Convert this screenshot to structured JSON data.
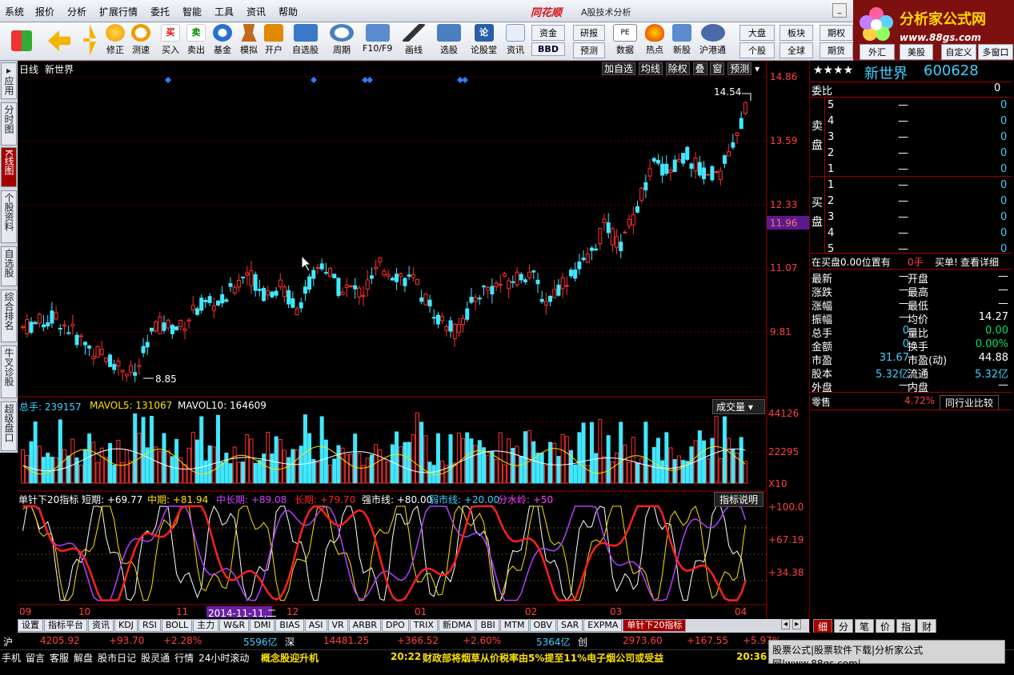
{
  "menubar": {
    "items": [
      "系统",
      "报价",
      "分析",
      "扩展行情",
      "委托",
      "智能",
      "工具",
      "资讯",
      "帮助"
    ],
    "brand": "同花顺",
    "subtitle": "A股技术分析"
  },
  "logo": {
    "title": "分析家公式网",
    "url": "www.88gs.com"
  },
  "toolbar": {
    "buttons": [
      "修正",
      "测速",
      "买入",
      "卖出",
      "基金",
      "模拟",
      "开户",
      "自选股",
      "周期",
      "F10/F9",
      "画线",
      "选股",
      "论股堂",
      "资讯",
      "数据",
      "热点",
      "新股",
      "沪港通"
    ],
    "small": [
      "资金",
      "研报",
      "BBD",
      "预测",
      "大盘",
      "板块",
      "期权",
      "个股",
      "全球",
      "期货",
      "外汇",
      "美股",
      "自定义",
      "多窗口"
    ]
  },
  "sidetabs": [
    "应用",
    "分时图",
    "K线图",
    "个股资料",
    "自选股",
    "综合排名",
    "牛叉诊股",
    "超级盘口"
  ],
  "chart": {
    "period": "日线",
    "stock": "新世界",
    "right_tools": [
      "加自选",
      "均线",
      "除权",
      "叠",
      "窗",
      "预测"
    ],
    "price_axis": [
      "14.86",
      "13.59",
      "12.33",
      "11.07",
      "9.81"
    ],
    "current_price": "11.96",
    "high_label": "14.54",
    "low_label": "8.85",
    "volume": {
      "label": "总手: 239157",
      "ma5": "MAVOL5: 131067",
      "ma10": "MAVOL10: 164609",
      "selector": "成交量",
      "axis": [
        "44126",
        "22295",
        "X10"
      ]
    },
    "indicator": {
      "name": "单针下20指标",
      "short": "短期: +69.77",
      "mid": "中期: +81.94",
      "midlong": "中长期: +89.08",
      "long": "长期: +79.70",
      "strong": "强市线: +80.00",
      "weak": "弱市线: +20.00",
      "water": "分水岭: +50",
      "help": "指标说明",
      "axis": [
        "+100.0",
        "+67.19",
        "+34.38"
      ]
    },
    "date_axis": [
      "09",
      "10",
      "11",
      "2014-11-11,二",
      "12",
      "01",
      "02",
      "03",
      "04"
    ]
  },
  "bottom_tabs": [
    "设置",
    "指标平台",
    "资讯",
    "KDJ",
    "RSI",
    "BOLL",
    "主力",
    "W&R",
    "DMI",
    "BIAS",
    "ASI",
    "VR",
    "ARBR",
    "DPO",
    "TRIX",
    "新DMA",
    "BBI",
    "MTM",
    "OBV",
    "SAR",
    "EXPMA",
    "单针下20指标"
  ],
  "right_tabs": [
    "细",
    "分",
    "笔",
    "价",
    "指",
    "财"
  ],
  "quote": {
    "stars": "★★★★",
    "name": "新世界",
    "code": "600628",
    "weibi_label": "委比",
    "weibi_val": "0",
    "sell_label": "卖盘",
    "buy_label": "买盘",
    "levels": [
      "5",
      "4",
      "3",
      "2",
      "1"
    ],
    "dash": "—",
    "zero": "0",
    "position_text": "在买盘0.00位置有",
    "hands": "0手",
    "buy_order": "买单!",
    "detail": "查看详细",
    "rows": [
      [
        "最新",
        "—",
        "开盘",
        "—"
      ],
      [
        "涨跌",
        "—",
        "最高",
        "—"
      ],
      [
        "涨幅",
        "—",
        "最低",
        "—"
      ],
      [
        "振幅",
        "—",
        "均价",
        "14.27"
      ],
      [
        "总手",
        "0",
        "量比",
        "0.00"
      ],
      [
        "金额",
        "0",
        "换手",
        "0.00%"
      ],
      [
        "市盈",
        "31.67",
        "市盈(动)",
        "44.88"
      ],
      [
        "股本",
        "5.32亿",
        "流通",
        "5.32亿"
      ],
      [
        "外盘",
        "—",
        "内盘",
        "—"
      ]
    ],
    "industry_label": "零售",
    "industry_pct": "4.72%",
    "industry_compare": "同行业比较"
  },
  "ticker": {
    "sh": "沪",
    "sh_val": "4205.92",
    "sh_chg": "+93.70",
    "sh_pct": "+2.28%",
    "sh_amt": "5596亿",
    "sz": "深",
    "sz_val": "14481.25",
    "sz_chg": "+366.52",
    "sz_pct": "+2.60%",
    "sz_amt": "5364亿",
    "cy": "创",
    "cy_val": "2973.60",
    "cy_chg": "+167.55",
    "cy_pct": "+5.97%",
    "watermark": "股票公式|股票软件下载|分析家公式网|www.88gs.com|",
    "links": [
      "手机",
      "留言",
      "客服",
      "解盘",
      "股市日记",
      "股灵通",
      "行情",
      "24小时滚动"
    ],
    "news1": "概念股迎升机",
    "time1": "20:22",
    "news2": "财政部将烟草从价税率由5%提至11%电子烟公司或受益",
    "time2": "20:36"
  }
}
